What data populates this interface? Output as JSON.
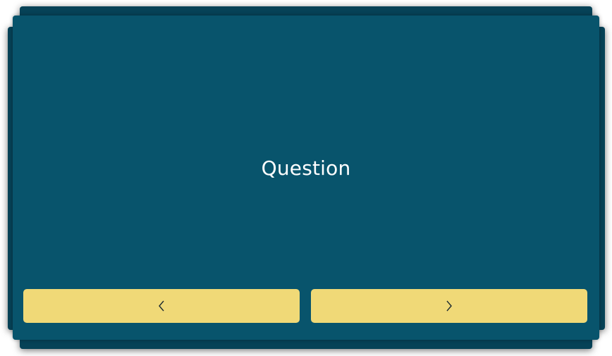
{
  "card": {
    "question_text": "Question"
  },
  "navigation": {
    "prev_icon": "chevron-left-icon",
    "next_icon": "chevron-right-icon"
  },
  "colors": {
    "card_background": "#08546c",
    "card_shadow_layer": "#064257",
    "button_background": "#f0d977",
    "text": "#ffffff",
    "icon": "#1c2a30"
  }
}
